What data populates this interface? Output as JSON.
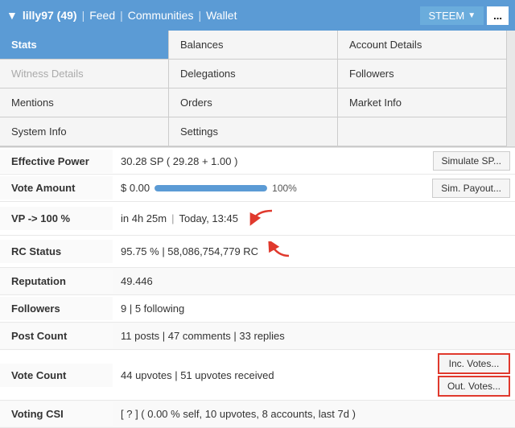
{
  "nav": {
    "username": "lilly97 (49)",
    "links": [
      "Feed",
      "Communities",
      "Wallet"
    ],
    "steem_label": "STEEM",
    "dots_label": "..."
  },
  "menu": {
    "items": [
      {
        "label": "Stats",
        "active": true,
        "disabled": false,
        "col": 1,
        "row": 1
      },
      {
        "label": "Balances",
        "active": false,
        "disabled": false,
        "col": 2,
        "row": 1
      },
      {
        "label": "Account Details",
        "active": false,
        "disabled": false,
        "col": 3,
        "row": 1
      },
      {
        "label": "Witness Details",
        "active": false,
        "disabled": true,
        "col": 1,
        "row": 2
      },
      {
        "label": "Delegations",
        "active": false,
        "disabled": false,
        "col": 2,
        "row": 2
      },
      {
        "label": "Followers",
        "active": false,
        "disabled": false,
        "col": 3,
        "row": 2
      },
      {
        "label": "Mentions",
        "active": false,
        "disabled": false,
        "col": 1,
        "row": 3
      },
      {
        "label": "Orders",
        "active": false,
        "disabled": false,
        "col": 2,
        "row": 3
      },
      {
        "label": "Market Info",
        "active": false,
        "disabled": false,
        "col": 3,
        "row": 3
      },
      {
        "label": "System Info",
        "active": false,
        "disabled": false,
        "col": 1,
        "row": 4
      },
      {
        "label": "Settings",
        "active": false,
        "disabled": false,
        "col": 2,
        "row": 4
      },
      {
        "label": "",
        "active": false,
        "disabled": false,
        "col": 3,
        "row": 4
      }
    ]
  },
  "stats": {
    "effective_power_label": "Effective Power",
    "effective_power_value": "30.28 SP ( 29.28 + 1.00 )",
    "simulate_sp_label": "Simulate SP...",
    "vote_amount_label": "Vote Amount",
    "vote_amount_value": "$ 0.00",
    "vote_pct": "100%",
    "vote_bar_pct": 100,
    "sim_payout_label": "Sim. Payout...",
    "vp_label": "VP -> 100 %",
    "vp_value": "in 4h 25m",
    "vp_time": "Today, 13:45",
    "rc_label": "RC Status",
    "rc_value": "95.75 %  |  58,086,754,779 RC",
    "reputation_label": "Reputation",
    "reputation_value": "49.446",
    "followers_label": "Followers",
    "followers_value": "9  |  5 following",
    "post_count_label": "Post Count",
    "post_count_value": "11 posts  |  47 comments  |  33 replies",
    "vote_count_label": "Vote Count",
    "vote_count_value": "44 upvotes  |  51 upvotes received",
    "inc_votes_label": "Inc. Votes...",
    "out_votes_label": "Out. Votes...",
    "voting_csi_label": "Voting CSI",
    "voting_csi_value": "[ ? ] ( 0.00 % self, 10 upvotes, 8 accounts, last 7d )"
  }
}
